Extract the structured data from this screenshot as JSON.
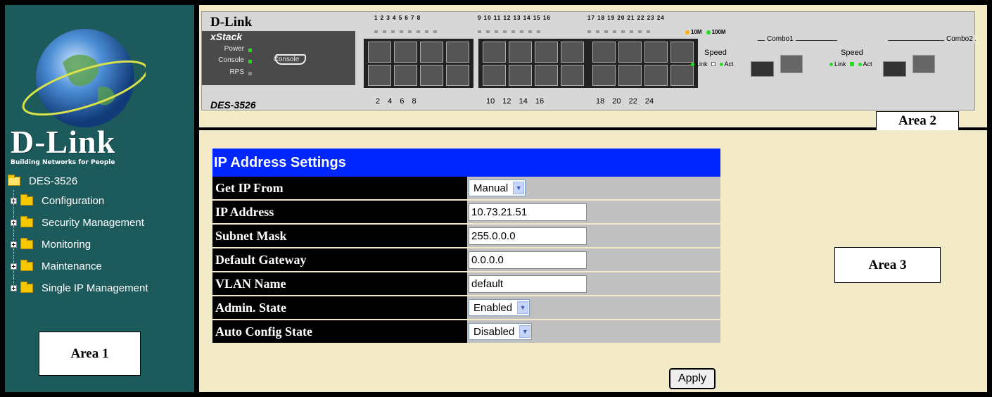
{
  "sidebar": {
    "brand": "D-Link",
    "tagline": "Building Networks for People",
    "root": "DES-3526",
    "items": [
      {
        "label": "Configuration"
      },
      {
        "label": "Security Management"
      },
      {
        "label": "Monitoring"
      },
      {
        "label": "Maintenance"
      },
      {
        "label": "Single IP Management"
      }
    ],
    "area_label": "Area 1"
  },
  "device": {
    "brand": "D-Link",
    "series": "xStack",
    "model": "DES-3526",
    "status_leds": [
      "Power",
      "Console",
      "RPS"
    ],
    "console_label": "Console",
    "port_numbers_top": [
      "1 2 3 4 5 6 7 8",
      "9 10 11 12 13 14 15 16",
      "17 18 19 20 21 22 23 24"
    ],
    "port_numbers_bottom": [
      "2 4 6 8",
      "10 12 14 16",
      "18 20 22 24"
    ],
    "legend": [
      "10M",
      "100M"
    ],
    "combo1": "Combo1",
    "combo2": "Combo2",
    "speed": "Speed",
    "link": "Link",
    "act": "Act",
    "area_label": "Area 2"
  },
  "form": {
    "title": "IP Address Settings",
    "fields": [
      {
        "label": "Get IP From",
        "value": "Manual"
      },
      {
        "label": "IP Address",
        "value": "10.73.21.51"
      },
      {
        "label": "Subnet Mask",
        "value": "255.0.0.0"
      },
      {
        "label": "Default Gateway",
        "value": "0.0.0.0"
      },
      {
        "label": "VLAN Name",
        "value": "default"
      },
      {
        "label": "Admin. State",
        "value": "Enabled"
      },
      {
        "label": "Auto Config State",
        "value": "Disabled"
      }
    ],
    "apply_label": "Apply",
    "area_label": "Area 3"
  },
  "colors": {
    "sidebar_bg": "#1d5a5c",
    "title_bar": "#0026ff",
    "content_bg": "#f3ebc7",
    "led_green": "#22dd22",
    "led_amber": "#ffb000"
  }
}
